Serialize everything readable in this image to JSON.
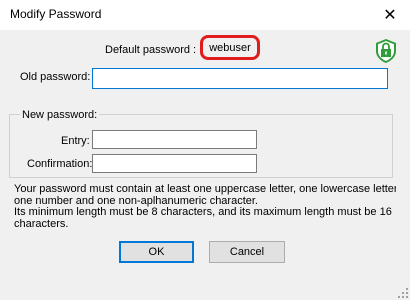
{
  "window": {
    "title": "Modify Password"
  },
  "default_password": {
    "label": "Default password :",
    "value": "webuser"
  },
  "old_password": {
    "label": "Old password:",
    "value": ""
  },
  "new_password": {
    "group_label": "New password:",
    "entry_label": "Entry:",
    "entry_value": "",
    "confirmation_label": "Confirmation:",
    "confirmation_value": ""
  },
  "help_text": [
    "Your password must contain at least one uppercase letter, one lowercase letter,",
    "one number and one non-aplhanumeric character.",
    "Its minimum length must be 8 characters, and its maximum length must be 16",
    "characters."
  ],
  "buttons": {
    "ok": "OK",
    "cancel": "Cancel"
  },
  "icons": {
    "close": "close-icon",
    "lock": "lock-icon",
    "grip": "resize-grip-icon"
  },
  "colors": {
    "highlight": "#e01c1c",
    "lock_green": "#2e9d3a",
    "focus_blue": "#0078d7"
  }
}
